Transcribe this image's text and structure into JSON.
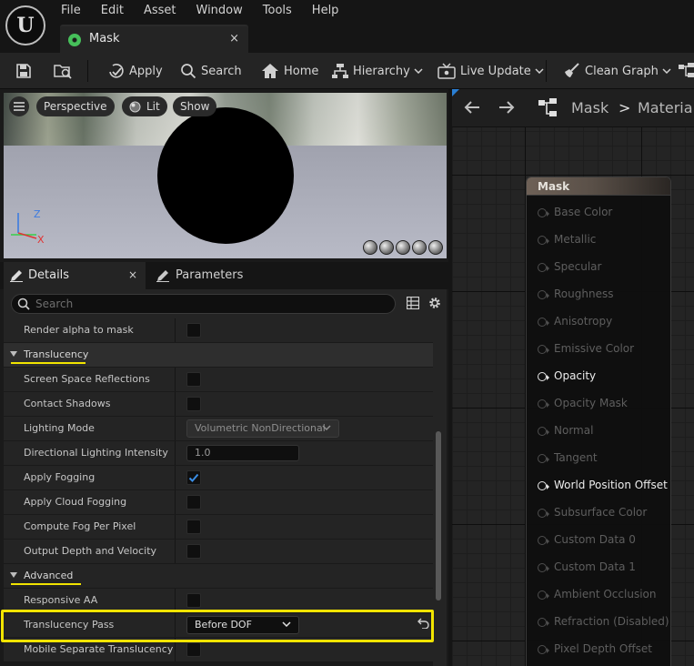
{
  "menu": [
    "File",
    "Edit",
    "Asset",
    "Window",
    "Tools",
    "Help"
  ],
  "document_tab": {
    "label": "Mask",
    "close": "×"
  },
  "toolbar": {
    "apply": "Apply",
    "search": "Search",
    "home": "Home",
    "hierarchy": "Hierarchy",
    "live_update": "Live Update",
    "clean_graph": "Clean Graph"
  },
  "viewport": {
    "perspective": "Perspective",
    "lit": "Lit",
    "show": "Show",
    "axis_z": "Z",
    "axis_x": "X"
  },
  "details": {
    "tab_details": "Details",
    "tab_close": "×",
    "tab_parameters": "Parameters",
    "search_placeholder": "Search",
    "rows": {
      "render_alpha_to_mask": "Render alpha to mask",
      "translucency_category": "Translucency",
      "screen_space_reflections": "Screen Space Reflections",
      "contact_shadows": "Contact Shadows",
      "lighting_mode": "Lighting Mode",
      "lighting_mode_value": "Volumetric NonDirectional",
      "directional_lighting_intensity": "Directional Lighting Intensity",
      "directional_lighting_intensity_value": "1.0",
      "apply_fogging": "Apply Fogging",
      "apply_cloud_fogging": "Apply Cloud Fogging",
      "compute_fog_per_pixel": "Compute Fog Per Pixel",
      "output_depth_and_velocity": "Output Depth and Velocity",
      "advanced_category": "Advanced",
      "responsive_aa": "Responsive AA",
      "translucency_pass": "Translucency Pass",
      "translucency_pass_value": "Before DOF",
      "mobile_separate_translucency": "Mobile Separate Translucency"
    },
    "checked": {
      "apply_fogging": true
    }
  },
  "graph": {
    "breadcrumb_root": "Mask",
    "breadcrumb_sep": ">",
    "breadcrumb_next": "Materia",
    "node_title": "Mask",
    "pins": [
      {
        "label": "Base Color",
        "active": false
      },
      {
        "label": "Metallic",
        "active": false
      },
      {
        "label": "Specular",
        "active": false
      },
      {
        "label": "Roughness",
        "active": false
      },
      {
        "label": "Anisotropy",
        "active": false
      },
      {
        "label": "Emissive Color",
        "active": false
      },
      {
        "label": "Opacity",
        "active": true
      },
      {
        "label": "Opacity Mask",
        "active": false
      },
      {
        "label": "Normal",
        "active": false
      },
      {
        "label": "Tangent",
        "active": false
      },
      {
        "label": "World Position Offset",
        "active": true
      },
      {
        "label": "Subsurface Color",
        "active": false
      },
      {
        "label": "Custom Data 0",
        "active": false
      },
      {
        "label": "Custom Data 1",
        "active": false
      },
      {
        "label": "Ambient Occlusion",
        "active": false
      },
      {
        "label": "Refraction (Disabled)",
        "active": false
      },
      {
        "label": "Pixel Depth Offset",
        "active": false
      }
    ]
  },
  "colors": {
    "highlight": "#f2e400",
    "checkbox_accent": "#3a8ee6",
    "material_icon": "#46c05a"
  }
}
